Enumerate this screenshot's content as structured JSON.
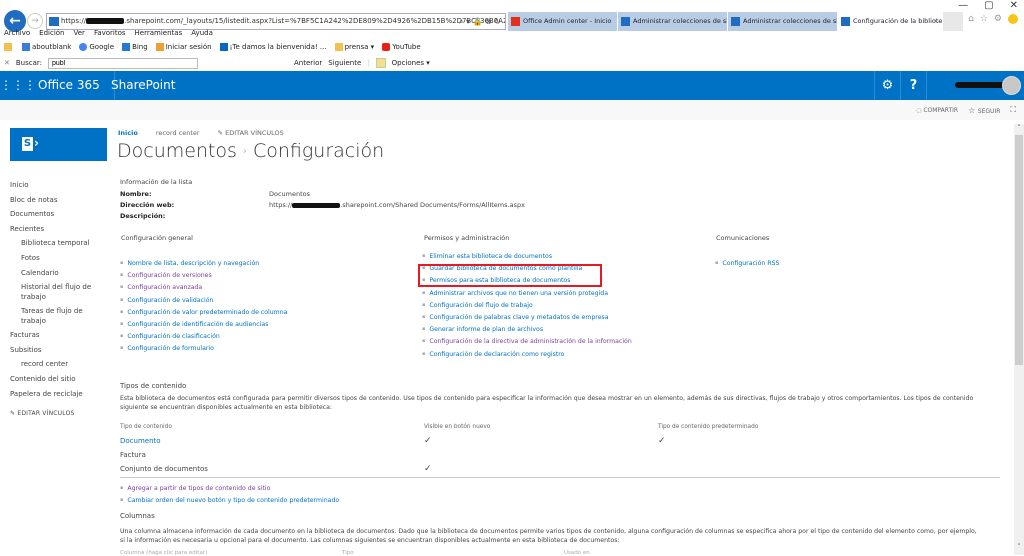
{
  "browser": {
    "url_prefix": "https://",
    "url_suffix": ".sharepoint.com/_layouts/15/listedit.aspx?List=%7BF5C1A242%2DE809%2D4926%2DB15B%2D7BCF36B0A28F%7D",
    "address_icons": "⌕ ▾ 🔒 ⊗ ↻",
    "tabs": [
      {
        "label": "Office Admin center - Inicio",
        "icon": "office-icon"
      },
      {
        "label": "Administrar colecciones de siti...",
        "icon": "sharepoint-icon"
      },
      {
        "label": "Administrar colecciones de siti...",
        "icon": "sharepoint-icon"
      },
      {
        "label": "Configuración de la bibliote...",
        "icon": "sharepoint-icon",
        "active": true
      }
    ],
    "window_controls": {
      "minimize": "—",
      "maximize": "▢",
      "close": "✕"
    },
    "menu": [
      "Archivo",
      "Edición",
      "Ver",
      "Favoritos",
      "Herramientas",
      "Ayuda"
    ],
    "favorites": [
      {
        "label": "aboutblank",
        "color": "#3b7dd8"
      },
      {
        "label": "Google",
        "color": "#4285f4"
      },
      {
        "label": "Bing",
        "color": "#1e7ad3"
      },
      {
        "label": "Iniciar sesión",
        "color": "#f0a030"
      },
      {
        "label": "¡Te damos la bienvenida! ...",
        "color": "#0a66c2"
      },
      {
        "label": "prensa ▾",
        "color": "#f2c14e"
      },
      {
        "label": "YouTube",
        "color": "#e62117"
      }
    ],
    "find": {
      "close": "✕",
      "label": "Buscar:",
      "value": "publ",
      "prev": "Anterior",
      "next": "Siguiente",
      "options": "Opciones ▾"
    }
  },
  "suite": {
    "app_launcher": "⋮⋮⋮",
    "office": "Office 365",
    "sharepoint": "SharePoint",
    "settings_icon": "⚙",
    "help_icon": "?"
  },
  "ribbon": {
    "share": "COMPARTIR",
    "follow": "SEGUIR",
    "focus_icon": "⛶"
  },
  "topnav": {
    "home": "Inicio",
    "record_center": "record center",
    "edit_links": "EDITAR VÍNCULOS"
  },
  "title": {
    "part1": "Documentos",
    "sep": "›",
    "part2": "Configuración"
  },
  "leftnav": {
    "items": [
      {
        "label": "Inicio",
        "level": 0
      },
      {
        "label": "Bloc de notas",
        "level": 0
      },
      {
        "label": "Documentos",
        "level": 0
      },
      {
        "label": "Recientes",
        "level": 0
      },
      {
        "label": "Biblioteca temporal",
        "level": 1
      },
      {
        "label": "Fotos",
        "level": 1
      },
      {
        "label": "Calendario",
        "level": 1
      },
      {
        "label": "Historial del flujo de trabajo",
        "level": 1
      },
      {
        "label": "Tareas de flujo de trabajo",
        "level": 1
      },
      {
        "label": "Facturas",
        "level": 0
      },
      {
        "label": "Subsitios",
        "level": 0
      },
      {
        "label": "record center",
        "level": 1
      },
      {
        "label": "Contenido del sitio",
        "level": 0
      },
      {
        "label": "Papelera de reciclaje",
        "level": 0
      }
    ],
    "edit_links": "EDITAR VÍNCULOS"
  },
  "list_info": {
    "heading": "Información de la lista",
    "name_label": "Nombre:",
    "name_value": "Documentos",
    "url_label": "Dirección web:",
    "url_prefix": "https://",
    "url_suffix": ".sharepoint.com/Shared Documents/Forms/AllItems.aspx",
    "desc_label": "Descripción:"
  },
  "general": {
    "heading": "Configuración general",
    "links": [
      {
        "label": "Nombre de lista, descripción y navegación",
        "visited": false
      },
      {
        "label": "Configuración de versiones",
        "visited": true
      },
      {
        "label": "Configuración avanzada",
        "visited": true
      },
      {
        "label": "Configuración de validación",
        "visited": false
      },
      {
        "label": "Configuración de valor predeterminado de columna",
        "visited": false
      },
      {
        "label": "Configuración de identificación de audiencias",
        "visited": false
      },
      {
        "label": "Configuración de clasificación",
        "visited": false
      },
      {
        "label": "Configuración de formulario",
        "visited": false
      }
    ]
  },
  "permissions": {
    "heading": "Permisos y administración",
    "links": [
      {
        "label": "Eliminar esta biblioteca de documentos",
        "visited": false
      },
      {
        "label": "Guardar biblioteca de documentos como plantilla",
        "visited": false,
        "highlighted": true
      },
      {
        "label": "Permisos para esta biblioteca de documentos",
        "visited": false
      },
      {
        "label": "Administrar archivos que no tienen una versión protegida",
        "visited": false
      },
      {
        "label": "Configuración del flujo de trabajo",
        "visited": false
      },
      {
        "label": "Configuración de palabras clave y metadatos de empresa",
        "visited": false
      },
      {
        "label": "Generar informe de plan de archivos",
        "visited": false
      },
      {
        "label": "Configuración de la directiva de administración de la información",
        "visited": true
      },
      {
        "label": "Configuración de declaración como registro",
        "visited": false
      }
    ]
  },
  "communications": {
    "heading": "Comunicaciones",
    "links": [
      {
        "label": "Configuración RSS",
        "visited": false
      }
    ]
  },
  "content_types": {
    "heading": "Tipos de contenido",
    "description": "Esta biblioteca de documentos está configurada para permitir diversos tipos de contenido. Use tipos de contenido para especificar la información que desea mostrar en un elemento, además de sus directivas, flujos de trabajo y otros comportamientos. Los tipos de contenido siguiente se encuentran disponibles actualmente en esta biblioteca:",
    "columns": [
      "Tipo de contenido",
      "Visible en botón nuevo",
      "Tipo de contenido predeterminado"
    ],
    "rows": [
      {
        "name": "Documento",
        "link": true,
        "visible": "✓",
        "default": "✓"
      },
      {
        "name": "Factura",
        "link": false,
        "visible": "",
        "default": ""
      },
      {
        "name": "Conjunto de documentos",
        "link": false,
        "visible": "✓",
        "default": ""
      }
    ],
    "links": [
      {
        "label": "Agregar a partir de tipos de contenido de sitio",
        "visited": true
      },
      {
        "label": "Cambiar orden del nuevo botón y tipo de contenido predeterminado",
        "visited": false
      }
    ]
  },
  "columns_section": {
    "heading": "Columnas",
    "description": "Una columna almacena información de cada documento en la biblioteca de documentos. Dado que la biblioteca de documentos permite varios tipos de contenido, alguna configuración de columnas se especifica ahora por el tipo de contenido del elemento como, por ejemplo, si la información es necesaria u opcional para el documento. Las columnas siguientes se encuentran disponibles actualmente en esta biblioteca de documentos:",
    "headers": [
      "Columna (haga clic para editar)",
      "Tipo",
      "Usado en"
    ]
  },
  "scrollbar": {
    "up": "˄",
    "down": "˅"
  }
}
